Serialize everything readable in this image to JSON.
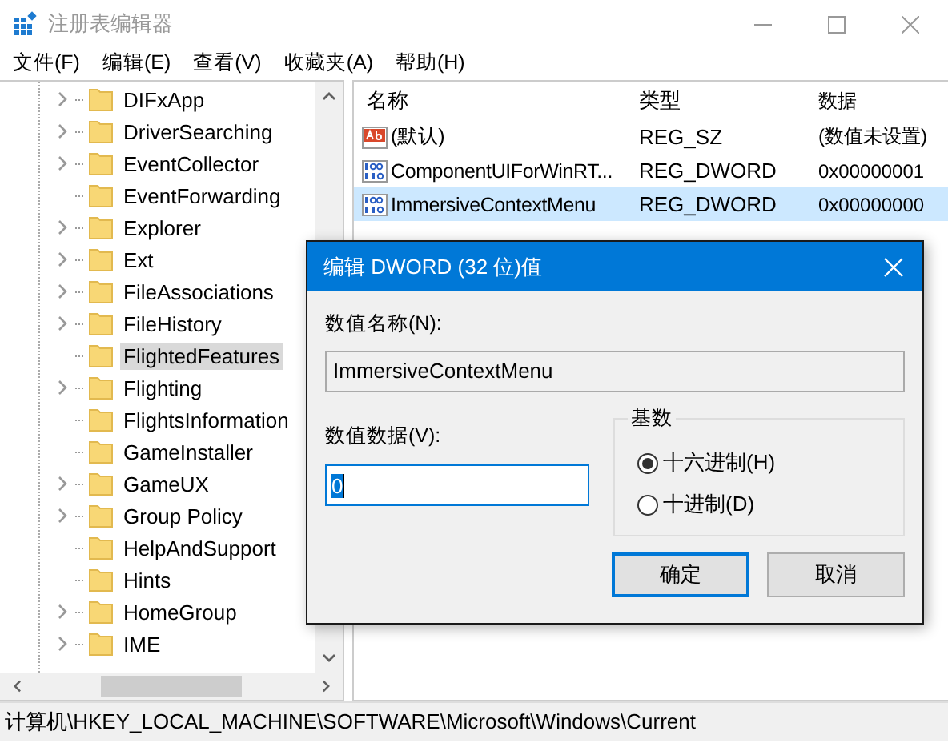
{
  "window": {
    "title": "注册表编辑器"
  },
  "menu": [
    "文件(F)",
    "编辑(E)",
    "查看(V)",
    "收藏夹(A)",
    "帮助(H)"
  ],
  "tree": [
    {
      "label": "DIFxApp",
      "expandable": true,
      "selected": false
    },
    {
      "label": "DriverSearching",
      "expandable": true,
      "selected": false
    },
    {
      "label": "EventCollector",
      "expandable": true,
      "selected": false
    },
    {
      "label": "EventForwarding",
      "expandable": false,
      "selected": false
    },
    {
      "label": "Explorer",
      "expandable": true,
      "selected": false
    },
    {
      "label": "Ext",
      "expandable": true,
      "selected": false
    },
    {
      "label": "FileAssociations",
      "expandable": true,
      "selected": false
    },
    {
      "label": "FileHistory",
      "expandable": true,
      "selected": false
    },
    {
      "label": "FlightedFeatures",
      "expandable": false,
      "selected": true
    },
    {
      "label": "Flighting",
      "expandable": true,
      "selected": false
    },
    {
      "label": "FlightsInformation",
      "expandable": false,
      "selected": false
    },
    {
      "label": "GameInstaller",
      "expandable": false,
      "selected": false
    },
    {
      "label": "GameUX",
      "expandable": true,
      "selected": false
    },
    {
      "label": "Group Policy",
      "expandable": true,
      "selected": false
    },
    {
      "label": "HelpAndSupport",
      "expandable": false,
      "selected": false
    },
    {
      "label": "Hints",
      "expandable": false,
      "selected": false
    },
    {
      "label": "HomeGroup",
      "expandable": true,
      "selected": false
    },
    {
      "label": "IME",
      "expandable": true,
      "selected": false
    }
  ],
  "values": {
    "columns": [
      "名称",
      "类型",
      "数据"
    ],
    "rows": [
      {
        "kind": "sz",
        "name": "(默认)",
        "type": "REG_SZ",
        "data": "(数值未设置)",
        "selected": false
      },
      {
        "kind": "dword",
        "name": "ComponentUIForWinRT...",
        "type": "REG_DWORD",
        "data": "0x00000001",
        "selected": false
      },
      {
        "kind": "dword",
        "name": "ImmersiveContextMenu",
        "type": "REG_DWORD",
        "data": "0x00000000",
        "selected": true
      }
    ]
  },
  "status_bar": "计算机\\HKEY_LOCAL_MACHINE\\SOFTWARE\\Microsoft\\Windows\\Current",
  "dialog": {
    "title": "编辑 DWORD (32 位)值",
    "name_label": "数值名称(N):",
    "name_value": "ImmersiveContextMenu",
    "data_label": "数值数据(V):",
    "data_value": "0",
    "base_label": "基数",
    "radios": [
      {
        "label": "十六进制(H)",
        "selected": true
      },
      {
        "label": "十进制(D)",
        "selected": false
      }
    ],
    "buttons": [
      "确定",
      "取消"
    ]
  }
}
